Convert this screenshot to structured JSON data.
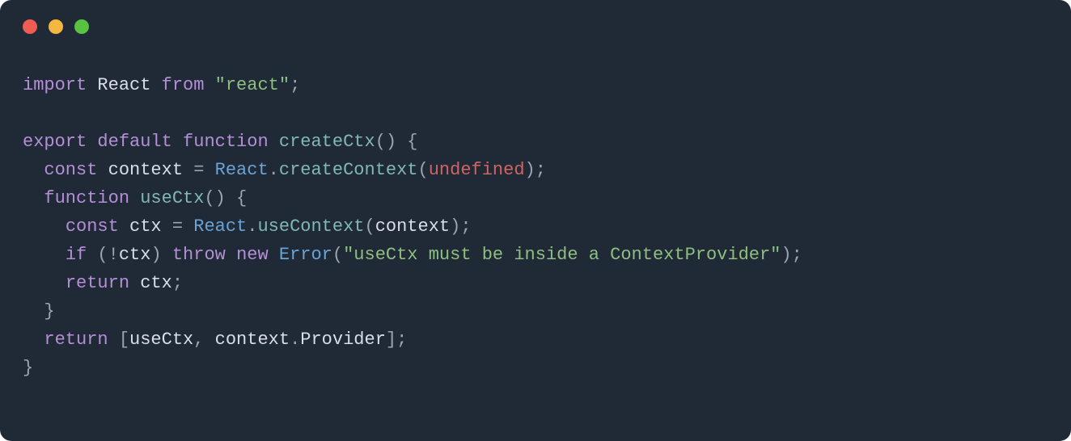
{
  "traffic_lights": {
    "red": "#ee5c53",
    "yellow": "#f4b840",
    "green": "#58c340"
  },
  "code": {
    "lines": [
      [
        {
          "cls": "kw",
          "t": "import"
        },
        {
          "cls": "punct",
          "t": " "
        },
        {
          "cls": "ident",
          "t": "React"
        },
        {
          "cls": "punct",
          "t": " "
        },
        {
          "cls": "kw",
          "t": "from"
        },
        {
          "cls": "punct",
          "t": " "
        },
        {
          "cls": "str",
          "t": "\"react\""
        },
        {
          "cls": "punct",
          "t": ";"
        }
      ],
      [],
      [
        {
          "cls": "kw",
          "t": "export"
        },
        {
          "cls": "punct",
          "t": " "
        },
        {
          "cls": "kw",
          "t": "default"
        },
        {
          "cls": "punct",
          "t": " "
        },
        {
          "cls": "kw",
          "t": "function"
        },
        {
          "cls": "punct",
          "t": " "
        },
        {
          "cls": "call",
          "t": "createCtx"
        },
        {
          "cls": "punct",
          "t": "() {"
        }
      ],
      [
        {
          "cls": "punct",
          "t": "  "
        },
        {
          "cls": "kw",
          "t": "const"
        },
        {
          "cls": "punct",
          "t": " "
        },
        {
          "cls": "ident",
          "t": "context"
        },
        {
          "cls": "punct",
          "t": " = "
        },
        {
          "cls": "type",
          "t": "React"
        },
        {
          "cls": "punct",
          "t": "."
        },
        {
          "cls": "call",
          "t": "createContext"
        },
        {
          "cls": "punct",
          "t": "("
        },
        {
          "cls": "undef",
          "t": "undefined"
        },
        {
          "cls": "punct",
          "t": ");"
        }
      ],
      [
        {
          "cls": "punct",
          "t": "  "
        },
        {
          "cls": "kw",
          "t": "function"
        },
        {
          "cls": "punct",
          "t": " "
        },
        {
          "cls": "call",
          "t": "useCtx"
        },
        {
          "cls": "punct",
          "t": "() {"
        }
      ],
      [
        {
          "cls": "punct",
          "t": "    "
        },
        {
          "cls": "kw",
          "t": "const"
        },
        {
          "cls": "punct",
          "t": " "
        },
        {
          "cls": "ident",
          "t": "ctx"
        },
        {
          "cls": "punct",
          "t": " = "
        },
        {
          "cls": "type",
          "t": "React"
        },
        {
          "cls": "punct",
          "t": "."
        },
        {
          "cls": "call",
          "t": "useContext"
        },
        {
          "cls": "punct",
          "t": "("
        },
        {
          "cls": "ident",
          "t": "context"
        },
        {
          "cls": "punct",
          "t": ");"
        }
      ],
      [
        {
          "cls": "punct",
          "t": "    "
        },
        {
          "cls": "kw",
          "t": "if"
        },
        {
          "cls": "punct",
          "t": " ("
        },
        {
          "cls": "op",
          "t": "!"
        },
        {
          "cls": "ident",
          "t": "ctx"
        },
        {
          "cls": "punct",
          "t": ") "
        },
        {
          "cls": "kw",
          "t": "throw"
        },
        {
          "cls": "punct",
          "t": " "
        },
        {
          "cls": "kw",
          "t": "new"
        },
        {
          "cls": "punct",
          "t": " "
        },
        {
          "cls": "type",
          "t": "Error"
        },
        {
          "cls": "punct",
          "t": "("
        },
        {
          "cls": "str",
          "t": "\"useCtx must be inside a ContextProvider\""
        },
        {
          "cls": "punct",
          "t": ");"
        }
      ],
      [
        {
          "cls": "punct",
          "t": "    "
        },
        {
          "cls": "kw",
          "t": "return"
        },
        {
          "cls": "punct",
          "t": " "
        },
        {
          "cls": "ident",
          "t": "ctx"
        },
        {
          "cls": "punct",
          "t": ";"
        }
      ],
      [
        {
          "cls": "punct",
          "t": "  }"
        }
      ],
      [
        {
          "cls": "punct",
          "t": "  "
        },
        {
          "cls": "kw",
          "t": "return"
        },
        {
          "cls": "punct",
          "t": " ["
        },
        {
          "cls": "ident",
          "t": "useCtx"
        },
        {
          "cls": "punct",
          "t": ", "
        },
        {
          "cls": "ident",
          "t": "context"
        },
        {
          "cls": "punct",
          "t": "."
        },
        {
          "cls": "ident",
          "t": "Provider"
        },
        {
          "cls": "punct",
          "t": "];"
        }
      ],
      [
        {
          "cls": "punct",
          "t": "}"
        }
      ]
    ]
  }
}
